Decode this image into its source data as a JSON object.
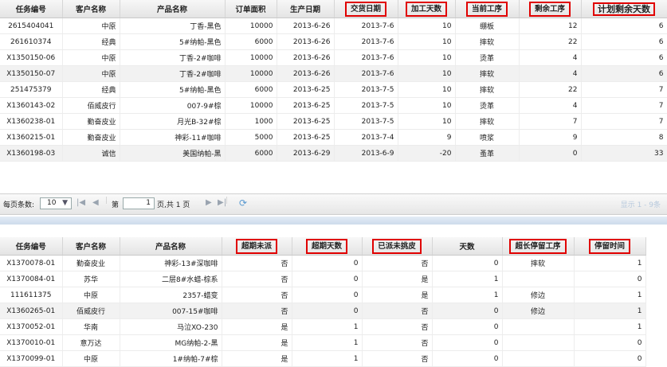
{
  "top_grid": {
    "headers": [
      "任务编号",
      "客户名称",
      "产品名称",
      "订单面积",
      "生产日期",
      "交货日期",
      "加工天数",
      "当前工序",
      "剩余工序",
      "计划剩余天数"
    ],
    "rows": [
      [
        "2615404041",
        "中原",
        "丁香-黑色",
        "10000",
        "2013-6-26",
        "2013-7-6",
        "10",
        "绷板",
        "12",
        "6"
      ],
      [
        "261610374",
        "经典",
        "5#纳帕-黑色",
        "6000",
        "2013-6-26",
        "2013-7-6",
        "10",
        "摔软",
        "22",
        "6"
      ],
      [
        "X1350150-06",
        "中原",
        "丁香-2#咖啡",
        "10000",
        "2013-6-26",
        "2013-7-6",
        "10",
        "烫革",
        "4",
        "6"
      ],
      [
        "X1350150-07",
        "中原",
        "丁香-2#咖啡",
        "10000",
        "2013-6-26",
        "2013-7-6",
        "10",
        "摔软",
        "4",
        "6"
      ],
      [
        "251475379",
        "经典",
        "5#纳帕-黑色",
        "6000",
        "2013-6-25",
        "2013-7-5",
        "10",
        "摔软",
        "22",
        "7"
      ],
      [
        "X1360143-02",
        "佰威皮行",
        "007-9#棕",
        "10000",
        "2013-6-25",
        "2013-7-5",
        "10",
        "烫革",
        "4",
        "7"
      ],
      [
        "X1360238-01",
        "勤奋皮业",
        "月光B-32#棕",
        "1000",
        "2013-6-25",
        "2013-7-5",
        "10",
        "摔软",
        "7",
        "7"
      ],
      [
        "X1360215-01",
        "勤奋皮业",
        "神彩-11#咖啡",
        "5000",
        "2013-6-25",
        "2013-7-4",
        "9",
        "喷浆",
        "9",
        "8"
      ],
      [
        "X1360198-03",
        "诚信",
        "美国纳帕-黑",
        "6000",
        "2013-6-29",
        "2013-6-9",
        "-20",
        "蚤革",
        "0",
        "33"
      ]
    ]
  },
  "pager": {
    "page_size_label": "每页条数:",
    "page_size": "10",
    "page_label": "第",
    "page_value": "1",
    "page_total": "页,共 1 页",
    "info": "显示 1 - 9条"
  },
  "bottom_grid": {
    "headers": [
      "任务编号",
      "客户名称",
      "产品名称",
      "超期未派",
      "超期天数",
      "已派未挑皮",
      "天数",
      "超长停留工序",
      "停留时间"
    ],
    "rows": [
      [
        "X1370078-01",
        "勤奋皮业",
        "神彩-13#深咖啡",
        "否",
        "0",
        "否",
        "0",
        "摔软",
        "1"
      ],
      [
        "X1370084-01",
        "苏华",
        "二层8#水蜡-棕系",
        "否",
        "0",
        "是",
        "1",
        "",
        "0"
      ],
      [
        "111611375",
        "中原",
        "2357-蜡变",
        "否",
        "0",
        "是",
        "1",
        "修边",
        "1"
      ],
      [
        "X1360265-01",
        "佰威皮行",
        "007-15#咖啡",
        "否",
        "0",
        "否",
        "0",
        "修边",
        "1"
      ],
      [
        "X1370052-01",
        "华南",
        "马泣XO-230",
        "是",
        "1",
        "否",
        "0",
        "",
        "1"
      ],
      [
        "X1370010-01",
        "意万达",
        "MG纳帕-2-黑",
        "是",
        "1",
        "否",
        "0",
        "",
        "0"
      ],
      [
        "X1370099-01",
        "中原",
        "1#纳帕-7#棕",
        "是",
        "1",
        "否",
        "0",
        "",
        "0"
      ]
    ]
  }
}
